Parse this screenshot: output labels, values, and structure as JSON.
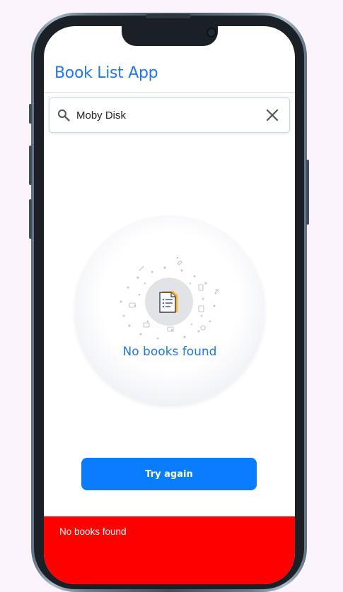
{
  "app": {
    "title": "Book List App"
  },
  "search": {
    "value": "Moby Disk",
    "icon": "search-icon",
    "clear_icon": "close-icon"
  },
  "empty_state": {
    "message": "No books found",
    "icon": "document-list-icon"
  },
  "actions": {
    "try_again_label": "Try again"
  },
  "snackbar": {
    "message": "No books found"
  },
  "colors": {
    "accent": "#1f7ae6",
    "button": "#0a7cff",
    "snackbar": "#ff0000",
    "page_background": "#fcf4fc"
  }
}
